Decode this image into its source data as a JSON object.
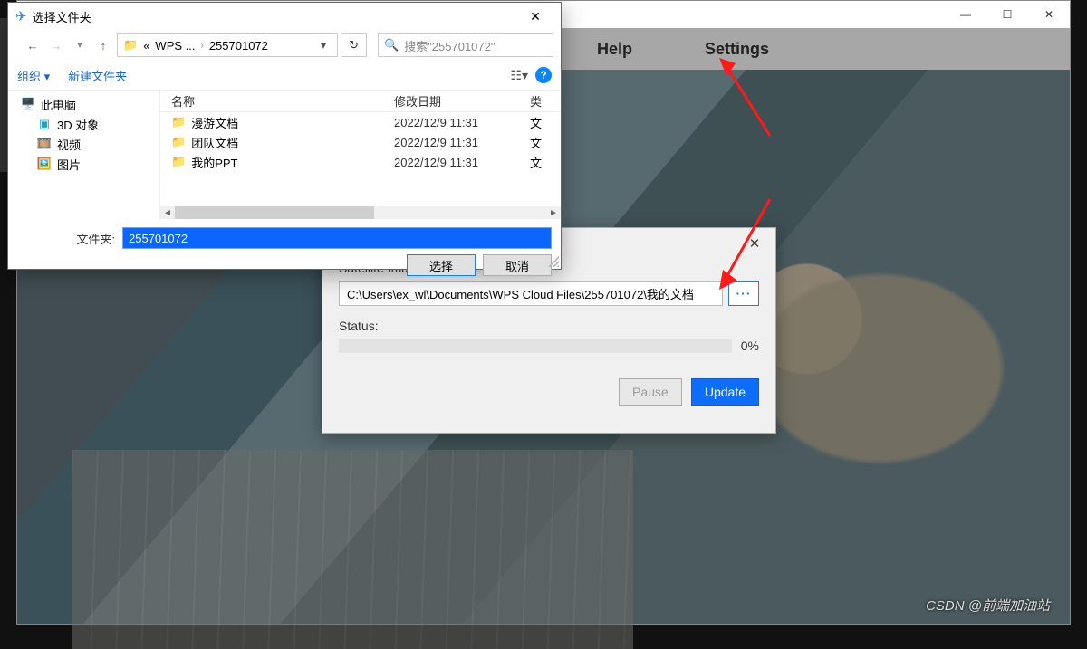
{
  "app": {
    "menu": {
      "help": "Help",
      "settings": "Settings"
    },
    "watermark": "CSDN @前端加油站"
  },
  "settings_dialog": {
    "path_label": "Satellite Images Path:",
    "path_value": "C:\\Users\\ex_wl\\Documents\\WPS Cloud Files\\255701072\\我的文档",
    "browse": "···",
    "status_label": "Status:",
    "percent": "0%",
    "pause": "Pause",
    "update": "Update"
  },
  "picker": {
    "title": "选择文件夹",
    "breadcrumb": {
      "seg1": "WPS ...",
      "seg2": "255701072"
    },
    "search_placeholder": "搜索\"255701072\"",
    "organize": "组织 ▾",
    "new_folder": "新建文件夹",
    "tree": {
      "this_pc": "此电脑",
      "objects3d": "3D 对象",
      "videos": "视频",
      "pictures": "图片"
    },
    "columns": {
      "name": "名称",
      "date": "修改日期",
      "type": "类"
    },
    "rows": [
      {
        "name": "漫游文档",
        "date": "2022/12/9 11:31",
        "type": "文"
      },
      {
        "name": "团队文档",
        "date": "2022/12/9 11:31",
        "type": "文"
      },
      {
        "name": "我的PPT",
        "date": "2022/12/9 11:31",
        "type": "文"
      }
    ],
    "folder_label": "文件夹:",
    "folder_value": "255701072",
    "select_btn": "选择",
    "cancel_btn": "取消"
  }
}
